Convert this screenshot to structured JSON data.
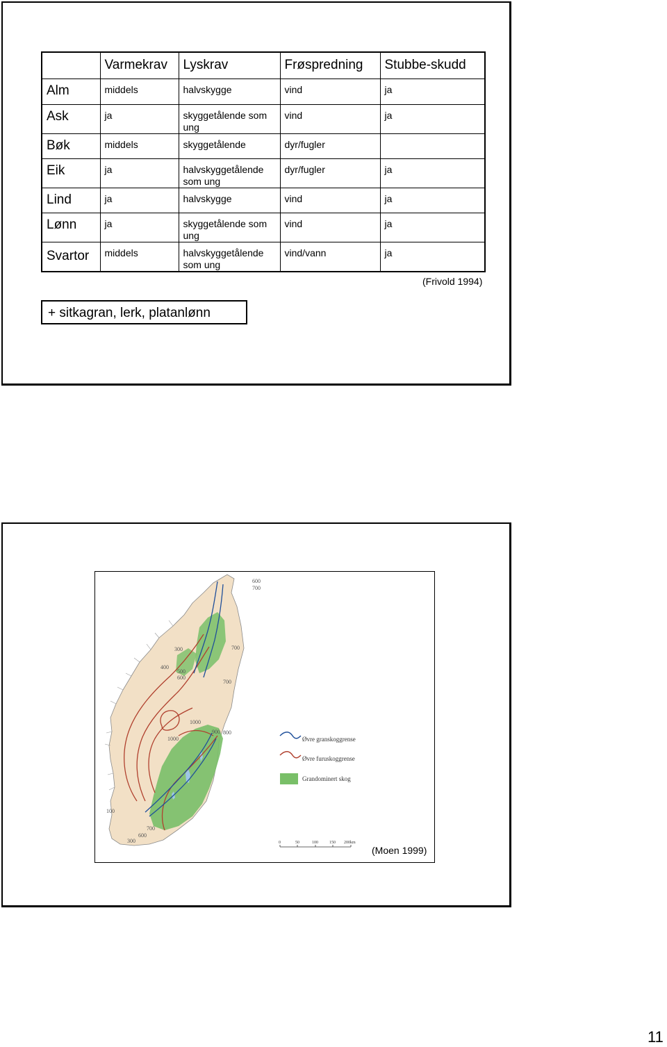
{
  "slide1": {
    "table": {
      "headers": [
        "",
        "Varmekrav",
        "Lyskrav",
        "Frøspredning",
        "Stubbe-skudd"
      ],
      "rows": [
        {
          "tree": "Alm",
          "varme": "middels",
          "lys": "halvskygge",
          "fro": "vind",
          "stubbe": "ja"
        },
        {
          "tree": "Ask",
          "varme": "ja",
          "lys": "skyggetålende som ung",
          "fro": "vind",
          "stubbe": "ja"
        },
        {
          "tree": "Bøk",
          "varme": "middels",
          "lys": "skyggetålende",
          "fro": "dyr/fugler",
          "stubbe": ""
        },
        {
          "tree": "Eik",
          "varme": "ja",
          "lys": "halvskyggetålende som ung",
          "fro": "dyr/fugler",
          "stubbe": "ja"
        },
        {
          "tree": "Lind",
          "varme": "ja",
          "lys": "halvskygge",
          "fro": "vind",
          "stubbe": "ja"
        },
        {
          "tree": "Lønn",
          "varme": "ja",
          "lys": "skyggetålende som ung",
          "fro": "vind",
          "stubbe": "ja"
        },
        {
          "tree": "Svartor",
          "varme": "middels",
          "lys": "halvskyggetålende som ung",
          "fro": "vind/vann",
          "stubbe": "ja"
        }
      ]
    },
    "citation": "(Frivold 1994)",
    "extra_species": "+ sitkagran, lerk, platanlønn"
  },
  "slide2": {
    "map": {
      "contour_labels": [
        "600",
        "700",
        "300",
        "700",
        "400",
        "500",
        "600",
        "700",
        "1000",
        "900",
        "800",
        "1000",
        "100",
        "700",
        "300",
        "600"
      ],
      "legend": {
        "spruce_line": "Øvre granskoggrense",
        "pine_line": "Øvre furuskoggrense",
        "spruce_area": "Grandominert skog"
      },
      "scale_labels": [
        "0",
        "50",
        "100",
        "150",
        "200km"
      ],
      "colors": {
        "spruce": "#1f4f9a",
        "pine": "#b0402e",
        "spruce_area": "#79bf68",
        "land": "#f2e0c6"
      }
    },
    "citation": "(Moen 1999)"
  },
  "page_number": "11"
}
